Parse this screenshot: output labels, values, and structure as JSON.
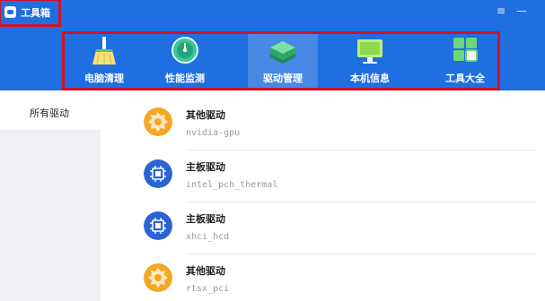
{
  "app": {
    "title": "工具箱",
    "icons": {
      "app": "toolbox-icon",
      "menu": "menu-icon",
      "minimize": "minimize-icon"
    },
    "colors": {
      "header": "#1f6fe0",
      "highlight_border": "#d0102a",
      "orange": "#f5a623",
      "blue": "#2a63d6"
    }
  },
  "nav": {
    "tabs": [
      {
        "label": "电脑清理",
        "icon": "broom-icon"
      },
      {
        "label": "性能监测",
        "icon": "gauge-icon"
      },
      {
        "label": "驱动管理",
        "icon": "layers-icon",
        "active": true
      },
      {
        "label": "本机信息",
        "icon": "monitor-icon"
      },
      {
        "label": "工具大全",
        "icon": "grid-apps-icon"
      }
    ]
  },
  "sidebar": {
    "items": [
      {
        "label": "所有驱动"
      }
    ]
  },
  "drivers": [
    {
      "name": "其他驱动",
      "device": "nvidia-gpu",
      "icon": "gear-icon"
    },
    {
      "name": "主板驱动",
      "device": "intel_pch_thermal",
      "icon": "chip-icon"
    },
    {
      "name": "主板驱动",
      "device": "xhci_hcd",
      "icon": "chip-icon"
    },
    {
      "name": "其他驱动",
      "device": "rtsx_pci",
      "icon": "gear-icon"
    }
  ]
}
